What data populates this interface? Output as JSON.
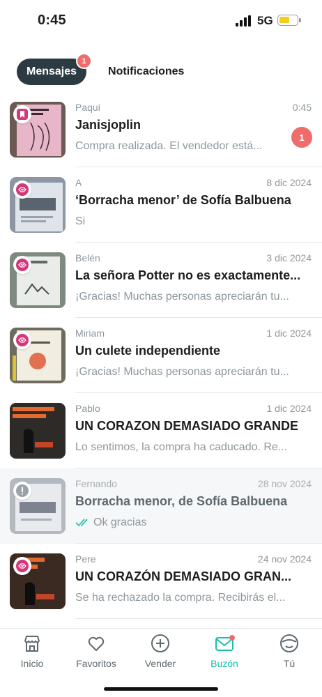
{
  "status_bar": {
    "time": "0:45",
    "network": "5G",
    "battery_color": "#f4cd1b"
  },
  "tabs": {
    "messages": {
      "label": "Mensajes",
      "badge": "1"
    },
    "notifications": {
      "label": "Notificaciones"
    }
  },
  "conversations": [
    {
      "sender": "Paqui",
      "date": "0:45",
      "title": "Janisjoplin",
      "preview": "Compra realizada. El vendedor está...",
      "unread": "1",
      "badge_icon": "bookmark-icon",
      "cover_color": "#e8b6c9"
    },
    {
      "sender": "A",
      "date": "8 dic 2024",
      "title": "‘Borracha menor’ de Sofía Balbuena",
      "preview": "Si",
      "badge_icon": "handshake-icon",
      "cover_color": "#b8c3cf"
    },
    {
      "sender": "Belén",
      "date": "3 dic 2024",
      "title": "La señora Potter no es exactamente...",
      "preview": "¡Gracias! Muchas personas apreciarán tu...",
      "badge_icon": "handshake-icon",
      "cover_color": "#aab5a8"
    },
    {
      "sender": "Miriam",
      "date": "1 dic 2024",
      "title": "Un culete independiente",
      "preview": "¡Gracias! Muchas personas apreciarán tu...",
      "badge_icon": "handshake-icon",
      "cover_color": "#d9d3bd"
    },
    {
      "sender": "Pablo",
      "date": "1 dic 2024",
      "title": "UN CORAZON DEMASIADO GRANDE",
      "preview": "Lo sentimos, la compra ha caducado. Re...",
      "badge_icon": "",
      "cover_color": "#2d2a28"
    },
    {
      "sender": "Fernando",
      "date": "28 nov 2024",
      "title": "Borracha menor, de Sofía Balbuena",
      "preview": "Ok gracias",
      "badge_icon": "info-icon",
      "cover_color": "#c9ccd1"
    },
    {
      "sender": "Pere",
      "date": "24 nov 2024",
      "title": "UN CORAZÓN DEMASIADO GRAN...",
      "preview": "Se ha rechazado la compra. Recibirás el...",
      "badge_icon": "handshake-icon",
      "cover_color": "#3a2a22"
    }
  ],
  "nav": [
    {
      "label": "Inicio",
      "icon": "shop-icon"
    },
    {
      "label": "Favoritos",
      "icon": "heart-icon"
    },
    {
      "label": "Vender",
      "icon": "plus-circle-icon"
    },
    {
      "label": "Buzón",
      "icon": "mail-icon",
      "active": true
    },
    {
      "label": "Tú",
      "icon": "face-icon"
    }
  ],
  "colors": {
    "accent": "#13c1ac",
    "badge": "#ee6d6a",
    "pink_badge": "#d7357a",
    "tab_dark": "#2c3a41"
  }
}
